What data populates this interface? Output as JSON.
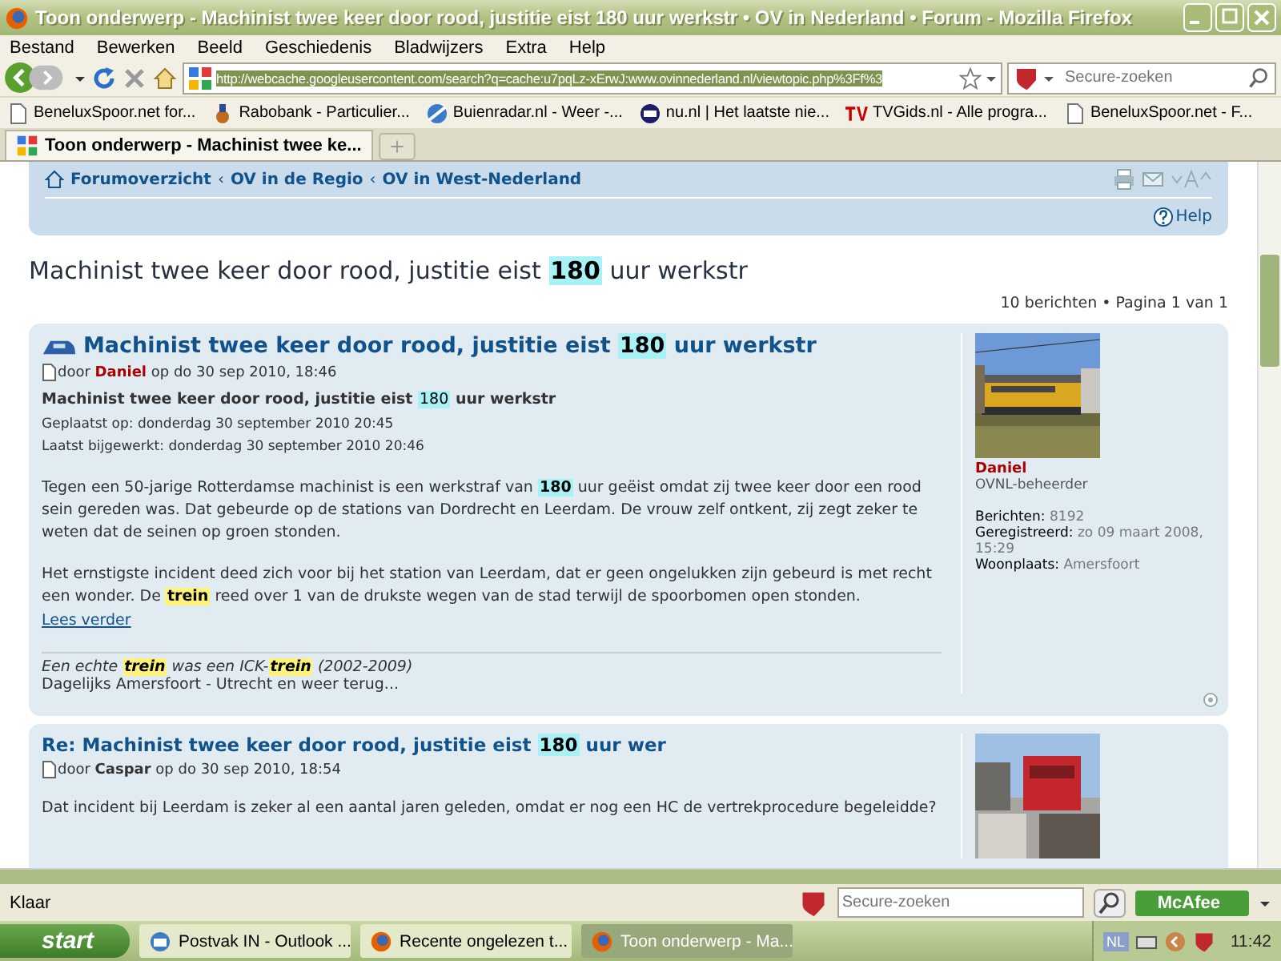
{
  "window": {
    "title": "Toon onderwerp - Machinist twee keer door rood, justitie eist 180 uur werkstr • OV in Nederland • Forum - Mozilla Firefox"
  },
  "menu": [
    "Bestand",
    "Bewerken",
    "Beeld",
    "Geschiedenis",
    "Bladwijzers",
    "Extra",
    "Help"
  ],
  "address": {
    "value": "http://webcache.googleusercontent.com/search?q=cache:u7pqLz-xErwJ:www.ovinnederland.nl/viewtopic.php%3Ff%3"
  },
  "search": {
    "placeholder": "Secure-zoeken"
  },
  "bookmarks": [
    {
      "label": "BeneluxSpoor.net for...",
      "kind": "page"
    },
    {
      "label": "Rabobank - Particulier...",
      "kind": "bank"
    },
    {
      "label": "Buienradar.nl - Weer -...",
      "kind": "globe"
    },
    {
      "label": "nu.nl | Het laatste nie...",
      "kind": "news"
    },
    {
      "label": "TVGids.nl - Alle progra...",
      "kind": "tv"
    },
    {
      "label": "BeneluxSpoor.net - F...",
      "kind": "page"
    }
  ],
  "tabs": [
    {
      "label": "Toon onderwerp - Machinist twee ke...",
      "selected": true
    }
  ],
  "breadcrumbs": [
    {
      "label": "Forumoverzicht"
    },
    {
      "separator": "‹",
      "label": "OV in de Regio"
    },
    {
      "separator": "‹",
      "label": "OV in West-Nederland"
    }
  ],
  "help": "Help",
  "topic_title": [
    {
      "text": "Machinist twee keer door rood, justitie eist "
    },
    {
      "text": "180",
      "color": "#a8f2f6"
    },
    {
      "text": " uur werkstr"
    }
  ],
  "pagination": "10 berichten • Pagina 1 van 1",
  "posts": [
    {
      "title": [
        {
          "text": "Machinist twee keer door rood, justitie eist "
        },
        {
          "text": "180",
          "color": "#a8f2f6"
        },
        {
          "text": " uur werkstr"
        }
      ],
      "byline": "door",
      "author": {
        "name": "Daniel",
        "color": "#aa0000"
      },
      "date": "op do 30 sep 2010, 18:46",
      "subtitle": [
        {
          "text": "Machinist twee keer door rood, justitie eist "
        },
        {
          "text": "180",
          "color": "#a8f2f6"
        },
        {
          "text": " uur werkstr"
        }
      ],
      "meta": [
        "Geplaatst op: donderdag 30 september 2010 20:45",
        "Laatst bijgewerkt: donderdag 30 september 2010 20:46"
      ],
      "paragraphs": [
        [
          {
            "text": "Tegen een 50-jarige Rotterdamse machinist is een werkstraf van "
          },
          {
            "text": "180",
            "color": "#a8f2f6"
          },
          {
            "text": " uur geëist omdat zij twee keer door een rood sein gereden was. Dat gebeurde op de stations van Dordrecht en Leerdam. De vrouw zelf ontkent, zij zegt zeker te weten dat de seinen op groen stonden."
          }
        ],
        [
          {
            "text": "Het ernstigste incident deed zich voor bij het station van Leerdam, dat er geen ongelukken zijn gebeurd is met recht een wonder. De "
          },
          {
            "text": "trein",
            "color": "#fff27a"
          },
          {
            "text": " reed over 1 van de drukste wegen van de stad terwijl de spoorbomen open stonden."
          }
        ]
      ],
      "link": "Lees verder",
      "signature": [
        [
          {
            "text": "Een echte "
          },
          {
            "text": "trein",
            "color": "#fff27a"
          },
          {
            "text": " was een ICK-"
          },
          {
            "text": "trein",
            "color": "#fff27a"
          },
          {
            "text": " (2002-2009)"
          }
        ],
        [
          {
            "text": "Dagelijks Amersfoort - Utrecht en weer terug..."
          }
        ]
      ],
      "profile": {
        "name": "Daniel",
        "rank": "OVNL-beheerder",
        "fields": [
          {
            "label": "Berichten:",
            "value": "8192"
          },
          {
            "label": "Geregistreerd:",
            "value": "zo 09 maart 2008, 15:29"
          },
          {
            "label": "Woonplaats:",
            "value": "Amersfoort"
          }
        ]
      }
    },
    {
      "title": [
        {
          "text": "Re: Machinist twee keer door rood, justitie eist "
        },
        {
          "text": "180",
          "color": "#a8f2f6"
        },
        {
          "text": " uur wer"
        }
      ],
      "byline": "door",
      "author": {
        "name": "Caspar",
        "color": "#333333"
      },
      "date": "op do 30 sep 2010, 18:54",
      "paragraphs": [
        [
          {
            "text": "Dat incident bij Leerdam is zeker al een aantal jaren geleden, omdat er nog een HC de vertrekprocedure begeleidde?"
          }
        ]
      ]
    }
  ],
  "status": "Klaar",
  "status_search": {
    "placeholder": "Secure-zoeken"
  },
  "mcafee": "McAfee",
  "taskbar": {
    "start": "start",
    "items": [
      {
        "label": "Postvak IN - Outlook ...",
        "kind": "mail",
        "selected": false
      },
      {
        "label": "Recente ongelezen t...",
        "kind": "browser",
        "selected": false
      },
      {
        "label": "Toon onderwerp - Ma...",
        "kind": "browser",
        "selected": true
      }
    ],
    "language": "NL",
    "clock": "11:42"
  }
}
